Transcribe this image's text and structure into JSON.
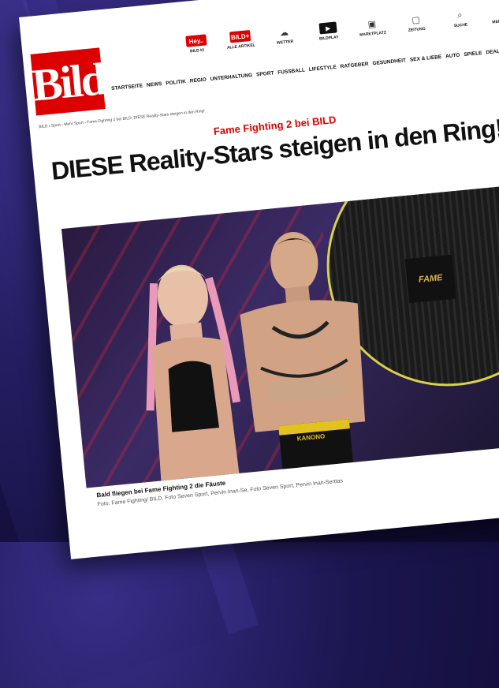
{
  "brand": {
    "logo": "Bild",
    "accent": "#dd0000"
  },
  "topbar": {
    "items": [
      {
        "icon": "hey-badge",
        "badge": "Hey..",
        "label": "BILD KI"
      },
      {
        "icon": "plus-badge",
        "badge": "BILD+",
        "label": "ALLE ARTIKEL"
      },
      {
        "icon": "weather-icon",
        "label": "WETTER"
      },
      {
        "icon": "play-icon",
        "label": "BILDPLAY"
      },
      {
        "icon": "shop-icon",
        "label": "MARKTPLATZ"
      },
      {
        "icon": "newspaper-icon",
        "label": "ZEITUNG"
      },
      {
        "icon": "search-icon",
        "label": "SUCHE"
      },
      {
        "icon": "user-icon",
        "label": "MEIN KONTO"
      }
    ]
  },
  "nav": {
    "items": [
      "STARTSEITE",
      "NEWS",
      "POLITIK",
      "REGIO",
      "UNTERHALTUNG",
      "SPORT",
      "FUSSBALL",
      "LIFESTYLE",
      "RATGEBER",
      "GESUNDHEIT",
      "SEX & LIEBE",
      "AUTO",
      "SPIELE",
      "DEALS"
    ]
  },
  "breadcrumb": "BILD › Sport › Mehr Sport › Fame Fighting 2 bei BILD: DIESE Reality-Stars steigen in den Ring!",
  "article": {
    "kicker": "Fame Fighting 2 bei BILD",
    "headline": "DIESE Reality-Stars steigen in den Ring!",
    "hero_logo": "FAME",
    "trunks_text": "KANONO",
    "caption": "Bald fliegen bei Fame Fighting 2 die Fäuste",
    "credit": "Foto: Fame Fighting/ BILD, Foto Seven Sport, Pervin Inan-Se, Foto Seven Sport, Pervin Inan-Serttas"
  }
}
